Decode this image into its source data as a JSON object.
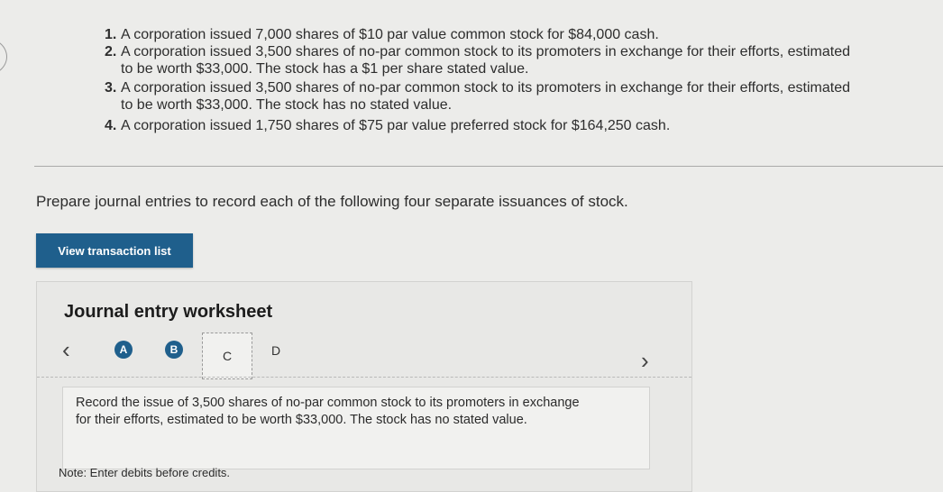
{
  "transactions": [
    {
      "num": "1.",
      "lines": [
        "A corporation issued 7,000 shares of $10 par value common stock for $84,000 cash."
      ]
    },
    {
      "num": "2.",
      "lines": [
        "A corporation issued 3,500 shares of no-par common stock to its promoters in exchange for their efforts, estimated",
        "to be worth $33,000. The stock has a $1 per share stated value."
      ]
    },
    {
      "num": "3.",
      "lines": [
        "A corporation issued 3,500 shares of no-par common stock to its promoters in exchange for their efforts, estimated",
        "to be worth $33,000. The stock has no stated value."
      ]
    },
    {
      "num": "4.",
      "lines": [
        "A corporation issued 1,750 shares of $75 par value preferred stock for $164,250 cash."
      ]
    }
  ],
  "prompt": "Prepare journal entries to record each of the following four separate issuances of stock.",
  "view_button_label": "View transaction list",
  "worksheet": {
    "title": "Journal entry worksheet",
    "prev_icon": "chevron-left-icon",
    "next_icon": "chevron-right-icon",
    "tabs": [
      {
        "label": "A",
        "state": "completed"
      },
      {
        "label": "B",
        "state": "completed"
      },
      {
        "label": "C",
        "state": "active"
      },
      {
        "label": "D",
        "state": "pending"
      }
    ],
    "instruction": "Record the issue of 3,500 shares of no-par common stock to its promoters in exchange for their efforts, estimated to be worth $33,000. The stock has no stated value.",
    "note": "Note: Enter debits before credits."
  },
  "colors": {
    "accent": "#1f5f8c",
    "background": "#ececea"
  }
}
